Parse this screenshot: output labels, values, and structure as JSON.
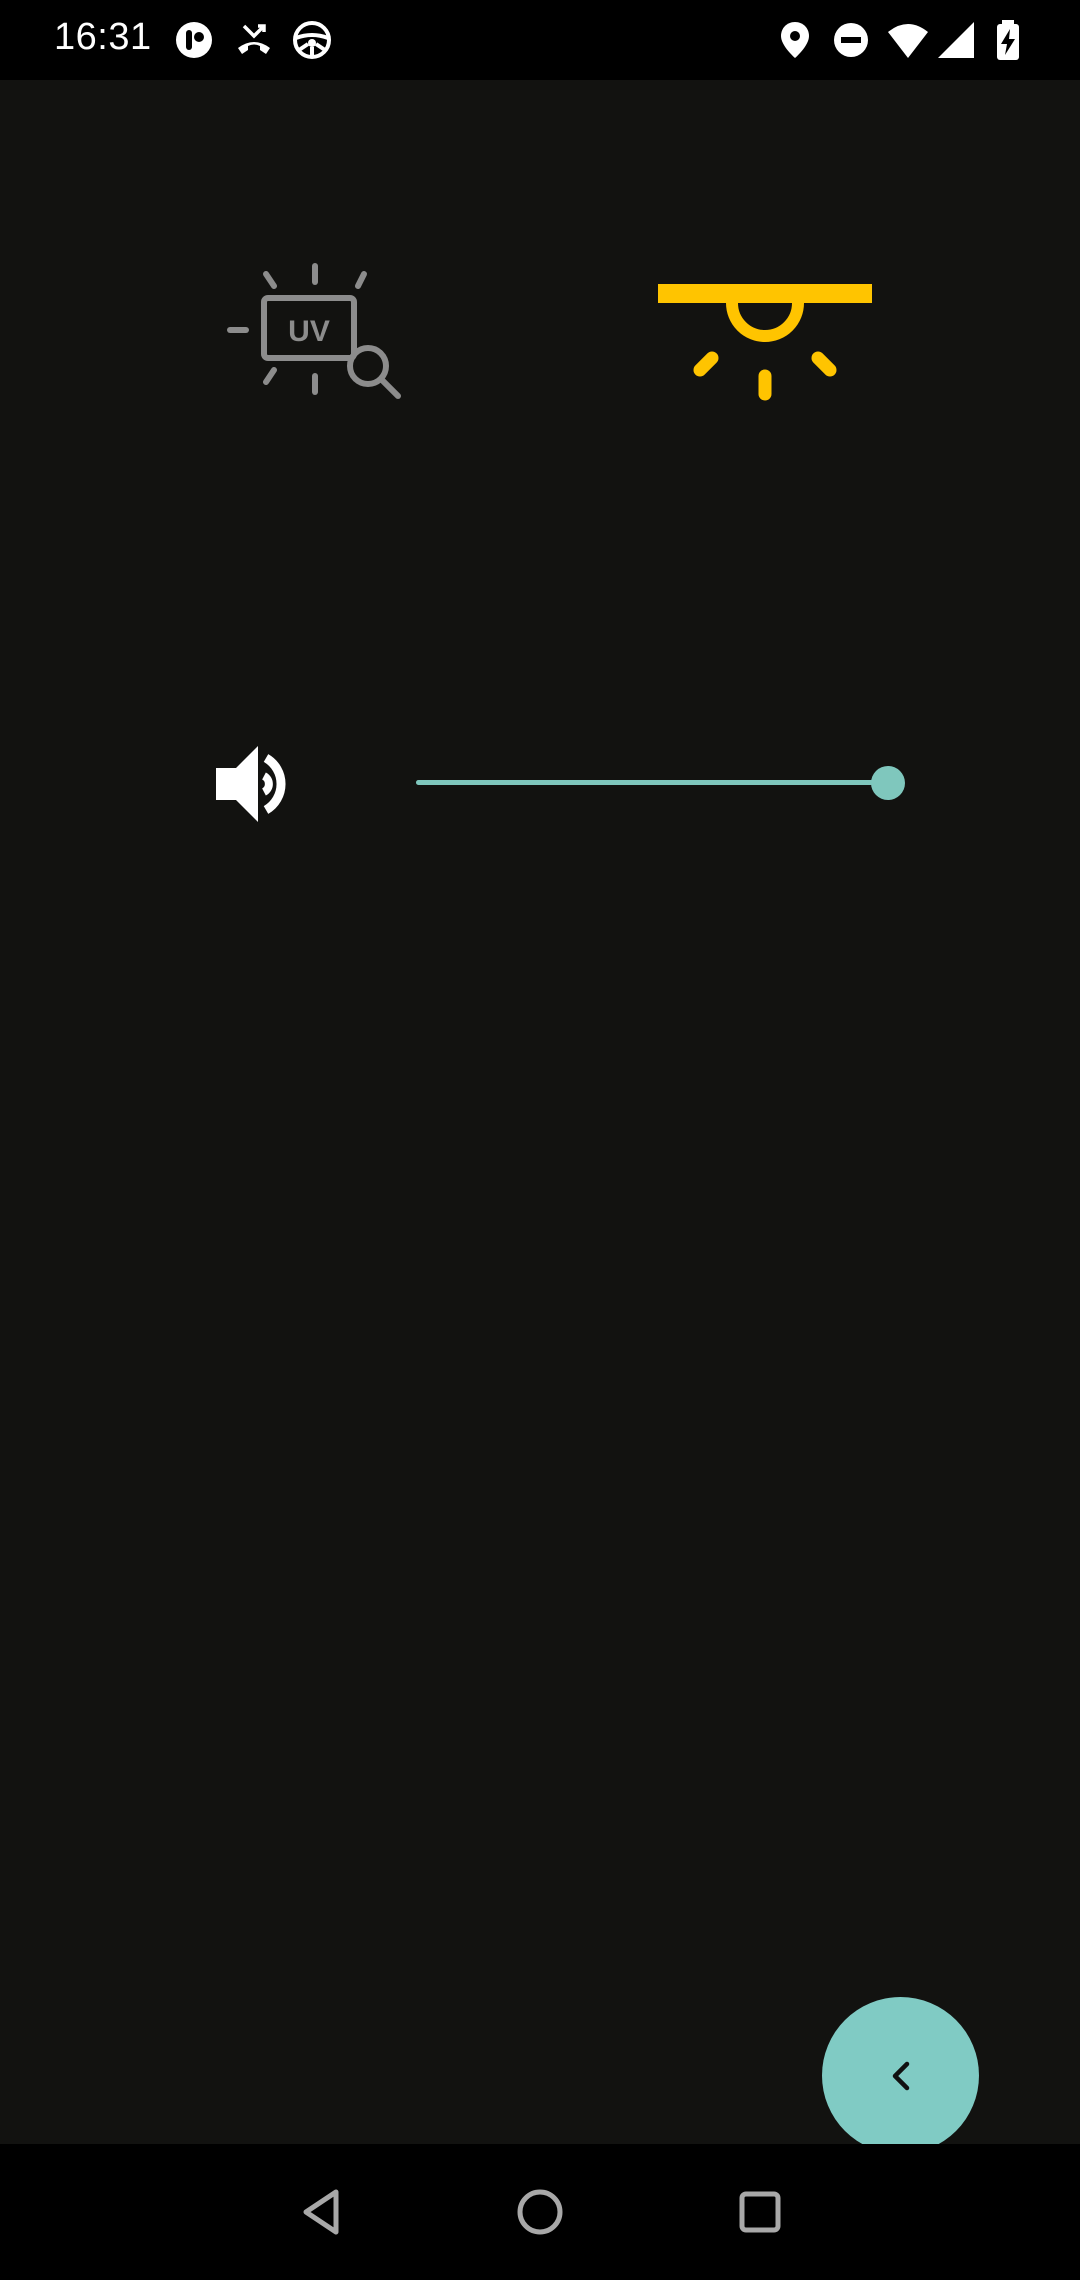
{
  "status_bar": {
    "time": "16:31",
    "left_icons": [
      "notification-app-icon",
      "missed-call-icon",
      "steering-wheel-icon"
    ],
    "right_icons": [
      "location-icon",
      "do-not-disturb-icon",
      "wifi-icon",
      "cell-signal-icon",
      "battery-charging-icon"
    ]
  },
  "modes": {
    "uv": {
      "label": "UV",
      "icon": "uv-inspection-icon",
      "color": "#8c8c8c",
      "active": false
    },
    "light": {
      "icon": "ceiling-light-icon",
      "color": "#ffc400",
      "active": true
    }
  },
  "volume": {
    "icon": "volume-up-icon",
    "level": 1.0,
    "color": "#7fc7bd"
  },
  "fab": {
    "icon": "chevron-left-icon",
    "color": "#80cbc4"
  },
  "navigation_bar": {
    "buttons": [
      "back-icon",
      "home-icon",
      "recents-icon"
    ]
  }
}
